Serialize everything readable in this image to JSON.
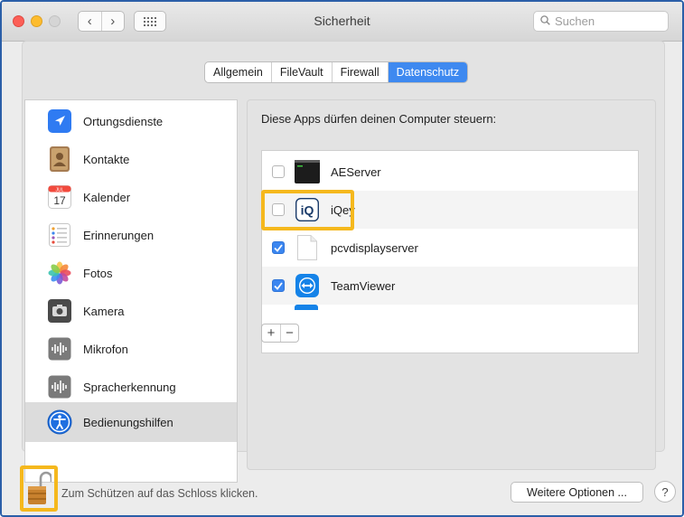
{
  "window": {
    "title": "Sicherheit",
    "nav_back": "‹",
    "nav_forward": "›",
    "search_placeholder": "Suchen"
  },
  "tabs": [
    {
      "label": "Allgemein",
      "active": false
    },
    {
      "label": "FileVault",
      "active": false
    },
    {
      "label": "Firewall",
      "active": false
    },
    {
      "label": "Datenschutz",
      "active": true
    }
  ],
  "sidebar": {
    "items": [
      {
        "label": "Ortungsdienste",
        "icon": "location-arrow-icon"
      },
      {
        "label": "Kontakte",
        "icon": "contacts-book-icon"
      },
      {
        "label": "Kalender",
        "icon": "calendar-icon",
        "calendar_month": "JUL",
        "calendar_day": "17"
      },
      {
        "label": "Erinnerungen",
        "icon": "reminders-icon"
      },
      {
        "label": "Fotos",
        "icon": "photos-flower-icon"
      },
      {
        "label": "Kamera",
        "icon": "camera-icon"
      },
      {
        "label": "Mikrofon",
        "icon": "microphone-waveform-icon"
      },
      {
        "label": "Spracherkennung",
        "icon": "speech-waveform-icon"
      },
      {
        "label": "Bedienungshilfen",
        "icon": "accessibility-icon",
        "selected": true
      }
    ]
  },
  "main": {
    "heading": "Diese Apps dürfen deinen Computer steuern:",
    "apps": [
      {
        "name": "AEServer",
        "checked": false,
        "icon": "terminal-icon"
      },
      {
        "name": "iQey",
        "checked": false,
        "icon": "iqey-app-icon",
        "icon_text": "iQ"
      },
      {
        "name": "pcvdisplayserver",
        "checked": true,
        "icon": "blank-document-icon"
      },
      {
        "name": "TeamViewer",
        "checked": true,
        "icon": "teamviewer-icon"
      }
    ],
    "add_label": "+",
    "remove_label": "−"
  },
  "footer": {
    "lock_message": "Zum Schützen auf das Schloss klicken.",
    "more_options_label": "Weitere Optionen ...",
    "help_label": "?"
  },
  "colors": {
    "accent": "#3e89f0",
    "highlight": "#f5b81d",
    "window_border": "#2b5fa8"
  }
}
